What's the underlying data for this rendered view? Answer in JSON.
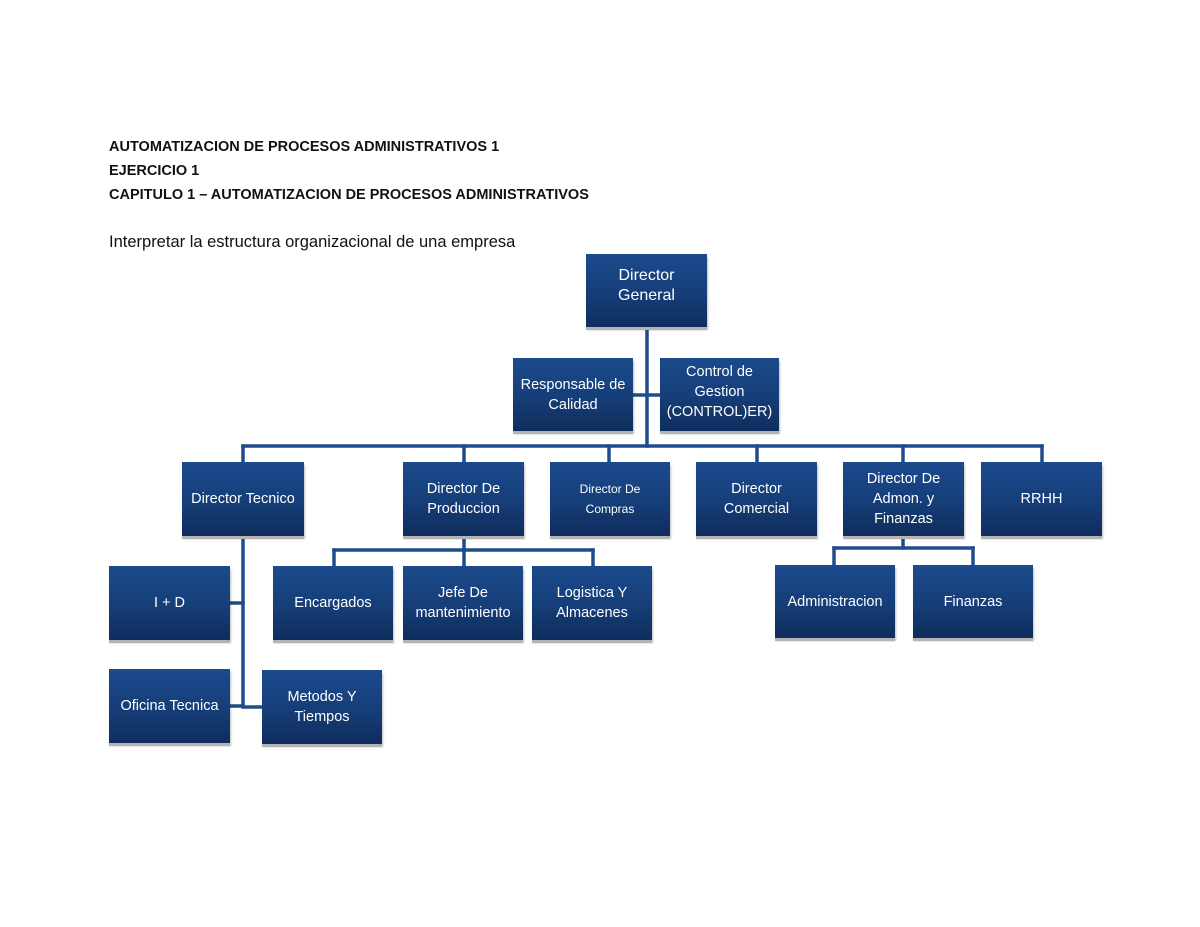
{
  "document": {
    "headings": [
      "AUTOMATIZACION DE PROCESOS ADMINISTRATIVOS 1",
      "EJERCICIO 1",
      "CAPITULO 1 – AUTOMATIZACION DE PROCESOS ADMINISTRATIVOS"
    ],
    "intro": "Interpretar la estructura organizacional de una empresa"
  },
  "org_chart": {
    "box_color_top": "#1b4a8c",
    "box_color_bottom": "#0f2d5c",
    "line_color": "#1f4d8a",
    "root": "Director General",
    "staff": {
      "left": "Responsable de Calidad",
      "right": "Control de Gestion (CONTROL)ER)"
    },
    "directors": [
      "Director Tecnico",
      "Director De Produccion",
      "Director De Compras",
      "Director Comercial",
      "Director De Admon. y Finanzas",
      "RRHH"
    ],
    "tecnico_children": [
      "I + D",
      "Oficina Tecnica",
      "Metodos Y Tiempos"
    ],
    "produccion_children": [
      "Encargados",
      "Jefe De mantenimiento",
      "Logistica Y Almacenes"
    ],
    "finanzas_children": [
      "Administracion",
      "Finanzas"
    ]
  }
}
